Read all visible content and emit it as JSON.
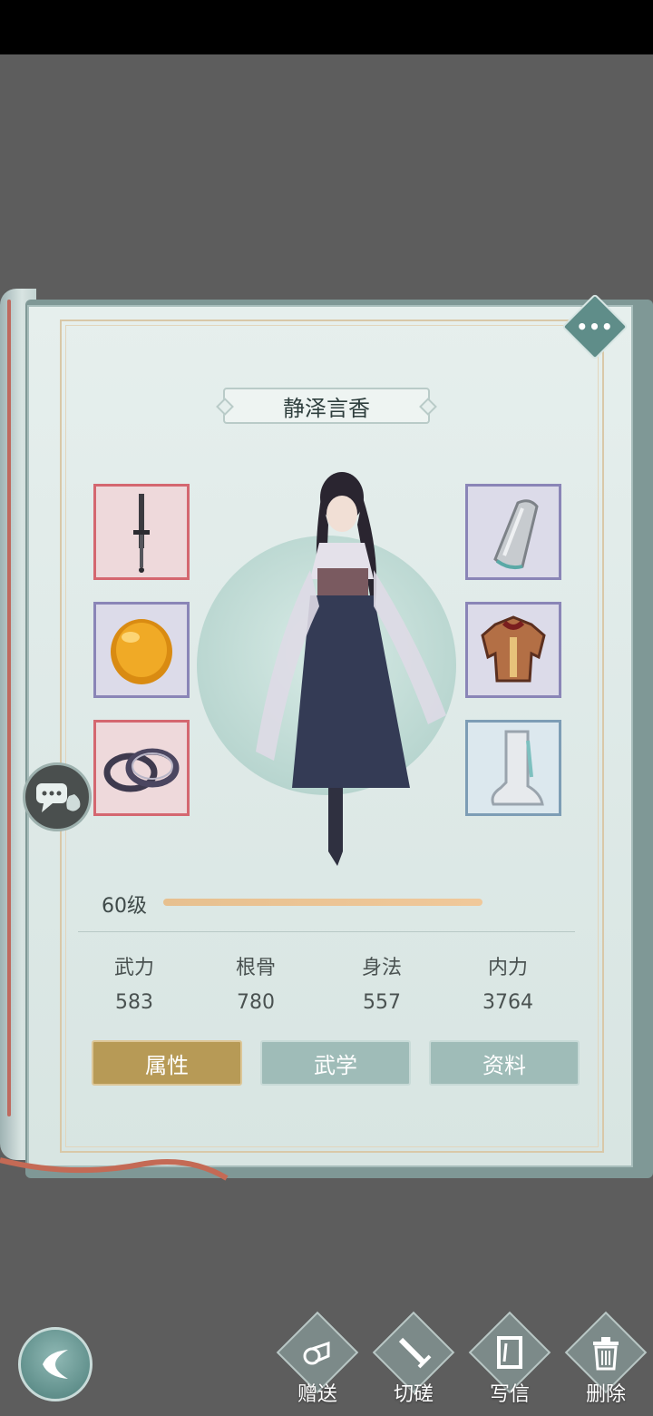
{
  "character": {
    "name": "静泽言香",
    "level": "60级",
    "level_progress": 1.0
  },
  "stats": [
    {
      "label": "武力",
      "value": "583"
    },
    {
      "label": "根骨",
      "value": "780"
    },
    {
      "label": "身法",
      "value": "557"
    },
    {
      "label": "内力",
      "value": "3764"
    }
  ],
  "tabs": [
    {
      "label": "属性",
      "active": true
    },
    {
      "label": "武学",
      "active": false
    },
    {
      "label": "资料",
      "active": false
    }
  ],
  "equipment": {
    "left": [
      {
        "icon": "dagger-icon",
        "rarity": "red"
      },
      {
        "icon": "amber-gem-icon",
        "rarity": "purple"
      },
      {
        "icon": "bracelets-icon",
        "rarity": "red"
      }
    ],
    "right": [
      {
        "icon": "bracer-icon",
        "rarity": "purple"
      },
      {
        "icon": "armor-icon",
        "rarity": "purple"
      },
      {
        "icon": "boots-icon",
        "rarity": "blue"
      }
    ]
  },
  "actions": [
    {
      "label": "赠送",
      "icon": "gift-scroll-icon"
    },
    {
      "label": "切磋",
      "icon": "sword-icon"
    },
    {
      "label": "写信",
      "icon": "letter-icon"
    },
    {
      "label": "删除",
      "icon": "trash-icon"
    }
  ],
  "colors": {
    "active_tab": "#b79a56",
    "inactive_tab": "#9fbcb8",
    "level_bar": "#f0c89a"
  },
  "menu": {
    "more_label": "•••"
  }
}
